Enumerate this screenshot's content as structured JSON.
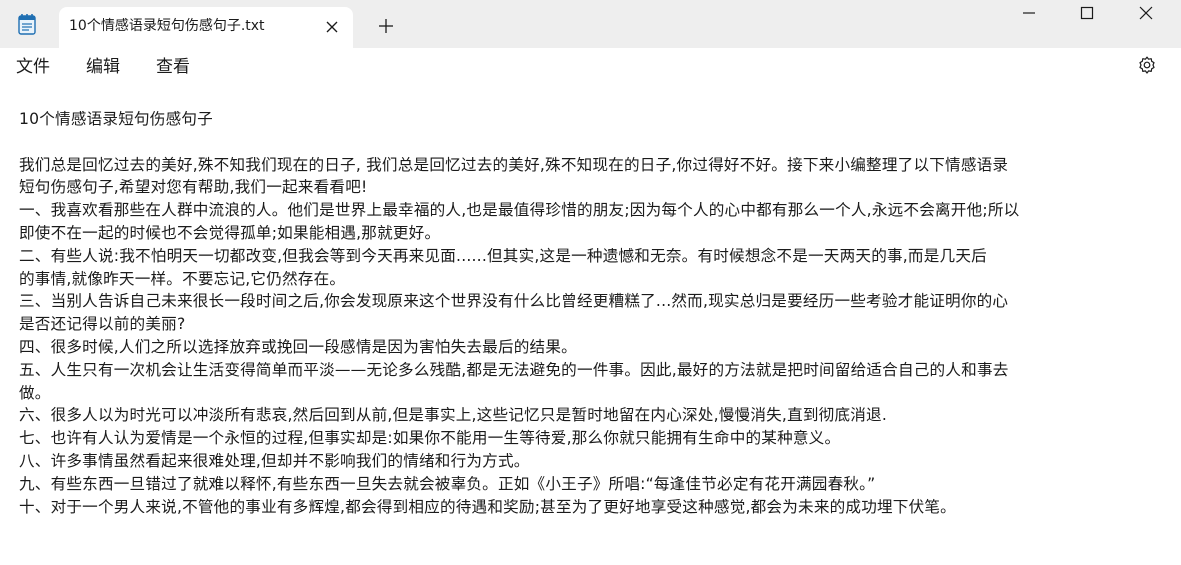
{
  "window": {
    "tab_title": "10个情感语录短句伤感句子.txt",
    "icons": {
      "app": "notepad-icon",
      "tab_close": "close-icon",
      "new_tab": "plus-icon",
      "minimize": "minimize-icon",
      "maximize": "maximize-icon",
      "close": "close-icon",
      "settings": "gear-icon"
    }
  },
  "menu": {
    "file": "文件",
    "edit": "编辑",
    "view": "查看"
  },
  "document": {
    "title": "10个情感语录短句伤感句子",
    "lines": [
      "我们总是回忆过去的美好,殊不知我们现在的日子, 我们总是回忆过去的美好,殊不知现在的日子,你过得好不好。接下来小编整理了以下情感语录",
      "短句伤感句子,希望对您有帮助,我们一起来看看吧!",
      "一、我喜欢看那些在人群中流浪的人。他们是世界上最幸福的人,也是最值得珍惜的朋友;因为每个人的心中都有那么一个人,永远不会离开他;所以",
      "即使不在一起的时候也不会觉得孤单;如果能相遇,那就更好。",
      "二、有些人说:我不怕明天一切都改变,但我会等到今天再来见面......但其实,这是一种遗憾和无奈。有时候想念不是一天两天的事,而是几天后",
      "的事情,就像昨天一样。不要忘记,它仍然存在。",
      "三、当别人告诉自己未来很长一段时间之后,你会发现原来这个世界没有什么比曾经更糟糕了...然而,现实总归是要经历一些考验才能证明你的心",
      "是否还记得以前的美丽?",
      "四、很多时候,人们之所以选择放弃或挽回一段感情是因为害怕失去最后的结果。",
      "五、人生只有一次机会让生活变得简单而平淡——无论多么残酷,都是无法避免的一件事。因此,最好的方法就是把时间留给适合自己的人和事去",
      "做。",
      "六、很多人以为时光可以冲淡所有悲哀,然后回到从前,但是事实上,这些记忆只是暂时地留在内心深处,慢慢消失,直到彻底消退.",
      "七、也许有人认为爱情是一个永恒的过程,但事实却是:如果你不能用一生等待爱,那么你就只能拥有生命中的某种意义。",
      "八、许多事情虽然看起来很难处理,但却并不影响我们的情绪和行为方式。",
      "九、有些东西一旦错过了就难以释怀,有些东西一旦失去就会被辜负。正如《小王子》所唱:“每逢佳节必定有花开满园春秋。”",
      "十、对于一个男人来说,不管他的事业有多辉煌,都会得到相应的待遇和奖励;甚至为了更好地享受这种感觉,都会为未来的成功埋下伏笔。"
    ]
  }
}
